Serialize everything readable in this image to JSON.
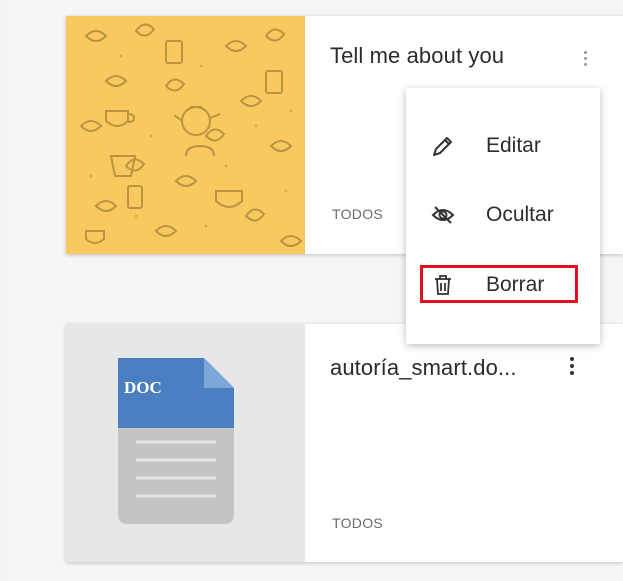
{
  "cards": [
    {
      "title": "Tell me about you",
      "category": "TODOS",
      "thumbnail": "tea-pattern",
      "thumbnail_color": "#f7c95f"
    },
    {
      "title": "autoría_smart.do...",
      "category": "TODOS",
      "thumbnail": "doc-file-icon",
      "file_badge": "DOC",
      "badge_color": "#4a7fc1"
    }
  ],
  "context_menu": {
    "items": [
      {
        "label": "Editar",
        "icon": "pencil-icon"
      },
      {
        "label": "Ocultar",
        "icon": "eye-slash-icon"
      },
      {
        "label": "Borrar",
        "icon": "trash-icon",
        "highlighted": true
      }
    ],
    "highlight_color": "#e0101c"
  }
}
